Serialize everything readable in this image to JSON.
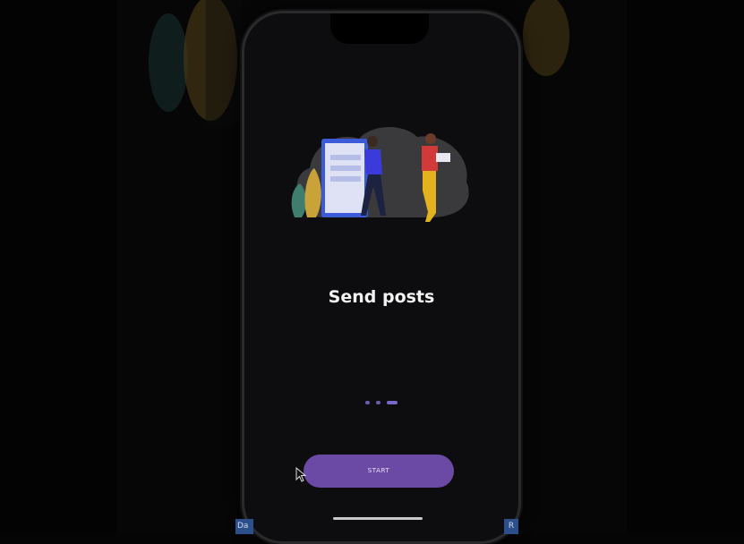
{
  "screen": {
    "title": "Send posts",
    "button_label": "START",
    "indicator_count": 3,
    "active_indicator": 2
  },
  "status": {
    "time": "",
    "icons": ""
  },
  "overlay": {
    "left_label": "Da",
    "right_label": "R"
  },
  "colors": {
    "accent": "#6b4aa5",
    "background": "#0d0d0f",
    "title": "#f2f2f2"
  },
  "icons": [
    "cursor-arrow-icon"
  ]
}
